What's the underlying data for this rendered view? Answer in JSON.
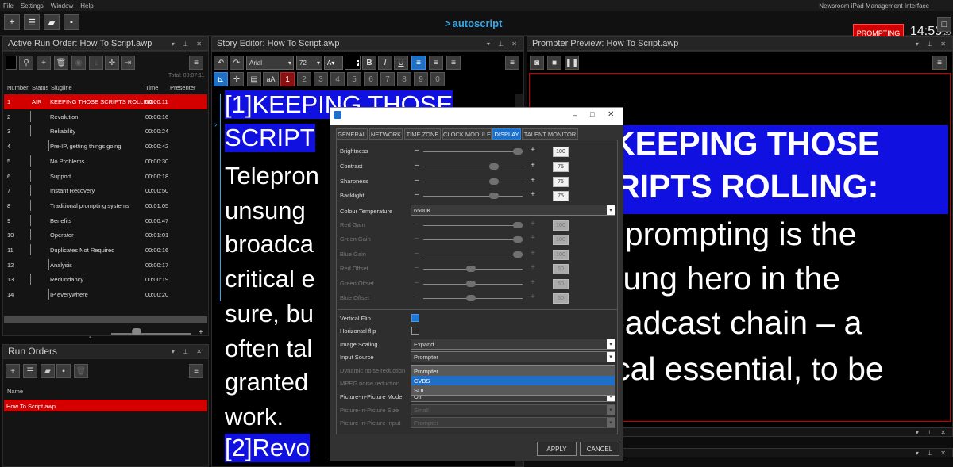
{
  "menu": [
    "File",
    "Settings",
    "Window",
    "Help"
  ],
  "menu_right": "Newsroom  iPad  Management Interface",
  "toolbar": {
    "logo": "autoscript",
    "logo_mark": ">",
    "prompting": "PROMPTING",
    "time": "14:53",
    "seconds": "29"
  },
  "run_order": {
    "title": "Active Run Order: How To Script.awp",
    "total": "Total: 00:07:11",
    "columns": [
      "Number",
      "Status",
      "Slugline",
      "Time",
      "Presenter"
    ],
    "rows": [
      {
        "num": "1",
        "status": "AIR",
        "slug": "KEEPING THOSE SCRIPTS ROLLING:",
        "time": "00:00:11"
      },
      {
        "num": "2",
        "status": "",
        "slug": "Revolution",
        "time": "00:00:16"
      },
      {
        "num": "3",
        "status": "",
        "slug": "Reliability",
        "time": "00:00:24"
      },
      {
        "num": "4",
        "status": "",
        "slug": "Pre-IP, getting things going",
        "time": "00:00:42"
      },
      {
        "num": "5",
        "status": "",
        "slug": "No Problems",
        "time": "00:00:30"
      },
      {
        "num": "6",
        "status": "",
        "slug": "Support",
        "time": "00:00:18"
      },
      {
        "num": "7",
        "status": "",
        "slug": "Instant Recovery",
        "time": "00:00:50"
      },
      {
        "num": "8",
        "status": "",
        "slug": "Traditional prompting systems",
        "time": "00:01:05"
      },
      {
        "num": "9",
        "status": "",
        "slug": "Benefits",
        "time": "00:00:47"
      },
      {
        "num": "10",
        "status": "",
        "slug": "Operator",
        "time": "00:01:01"
      },
      {
        "num": "11",
        "status": "",
        "slug": "Duplicates Not Required",
        "time": "00:00:16"
      },
      {
        "num": "12",
        "status": "",
        "slug": "Analysis",
        "time": "00:00:17"
      },
      {
        "num": "13",
        "status": "",
        "slug": "Redundancy",
        "time": "00:00:19"
      },
      {
        "num": "14",
        "status": "",
        "slug": "IP everywhere",
        "time": "00:00:20"
      }
    ]
  },
  "run_orders": {
    "title": "Run Orders",
    "column": "Name",
    "items": [
      "How To Script.awp"
    ]
  },
  "editor": {
    "title": "Story Editor: How To Script.awp",
    "font": "Arial",
    "size": "72",
    "markers": [
      "1",
      "2",
      "3",
      "4",
      "5",
      "6",
      "7",
      "8",
      "9",
      "0"
    ],
    "lines": [
      "[1]KEEPING THOSE",
      "SCRIPT",
      "Telepron",
      "unsung ",
      "broadca",
      "critical e",
      "sure, bu",
      "often tal",
      "granted ",
      "work.",
      "[2]Revo"
    ]
  },
  "preview": {
    "title": "Prompter Preview: How To Script.awp",
    "lines": [
      "KEEPING THOSE",
      "RIPTS ROLLING:",
      "eprompting is the",
      "sung hero in the",
      "oadcast chain – a",
      "ical essential, to be"
    ]
  },
  "dialog": {
    "tabs": [
      "GENERAL",
      "NETWORK",
      "TIME ZONE",
      "CLOCK MODULE",
      "DISPLAY",
      "TALENT MONITOR"
    ],
    "active_tab": "DISPLAY",
    "sliders": [
      {
        "label": "Brightness",
        "value": "100",
        "level": 100,
        "enabled": true
      },
      {
        "label": "Contrast",
        "value": "75",
        "level": 75,
        "enabled": true
      },
      {
        "label": "Sharpness",
        "value": "75",
        "level": 75,
        "enabled": true
      },
      {
        "label": "Backlight",
        "value": "75",
        "level": 75,
        "enabled": true
      }
    ],
    "colour_temp_label": "Colour Temperature",
    "colour_temp_value": "6500K",
    "rgb_sliders": [
      {
        "label": "Red Gain",
        "value": "100",
        "level": 100,
        "enabled": false
      },
      {
        "label": "Green Gain",
        "value": "100",
        "level": 100,
        "enabled": false
      },
      {
        "label": "Blue Gain",
        "value": "100",
        "level": 100,
        "enabled": false
      },
      {
        "label": "Red Offset",
        "value": "50",
        "level": 50,
        "enabled": false
      },
      {
        "label": "Green Offset",
        "value": "50",
        "level": 50,
        "enabled": false
      },
      {
        "label": "Blue Offset",
        "value": "50",
        "level": 50,
        "enabled": false
      }
    ],
    "vertical_flip": {
      "label": "Vertical Flip",
      "checked": true
    },
    "horizontal_flip": {
      "label": "Horizontal flip",
      "checked": false
    },
    "image_scaling": {
      "label": "Image Scaling",
      "value": "Expand"
    },
    "input_source": {
      "label": "Input Source",
      "value": "Prompter",
      "options": [
        "Prompter",
        "CVBS",
        "SDI"
      ],
      "highlighted": "CVBS"
    },
    "dynamic_noise": "Dynamic noise reduction",
    "mpeg_noise": "MPEG noise reduction",
    "pip_mode": {
      "label": "Picture-in-Picture Mode",
      "value": "Off"
    },
    "pip_size": {
      "label": "Picture-in-Picture Size",
      "value": "Small"
    },
    "pip_input": {
      "label": "Picture-in-Picture Input",
      "value": "Prompter"
    },
    "apply": "APPLY",
    "cancel": "CANCEL"
  }
}
